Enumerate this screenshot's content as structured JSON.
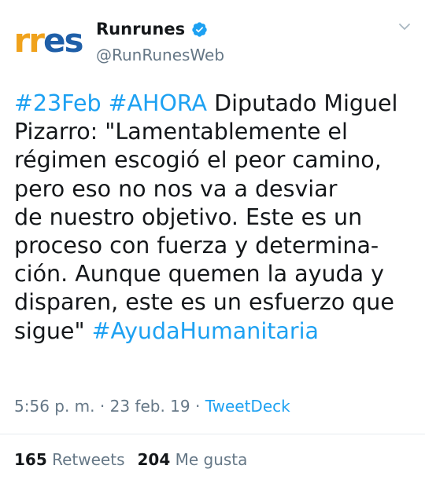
{
  "account": {
    "avatar_text_orange": "rr",
    "avatar_text_blue": "es",
    "display_name": "Runrunes",
    "verified_icon": "verified-badge-icon",
    "handle": "@RunRunesWeb",
    "menu_icon": "chevron-down-icon"
  },
  "tweet": {
    "lines": [
      [
        {
          "text": "#23Feb",
          "tag": true
        },
        {
          "text": " ",
          "tag": false
        },
        {
          "text": "#AHORA",
          "tag": true
        },
        {
          "text": " Diputado Miguel",
          "tag": false
        }
      ],
      [
        {
          "text": "Pizarro: \"Lamentablemente el",
          "tag": false
        }
      ],
      [
        {
          "text": "régimen escogió el peor camino,",
          "tag": false
        }
      ],
      [
        {
          "text": "pero eso no nos va a desviar",
          "tag": false
        }
      ],
      [
        {
          "text": "de nuestro objetivo. Este es un",
          "tag": false
        }
      ],
      [
        {
          "text": "proceso con fuerza y determina-",
          "tag": false
        }
      ],
      [
        {
          "text": "ción. Aunque quemen la ayuda y",
          "tag": false
        }
      ],
      [
        {
          "text": "disparen, este es un esfuerzo que",
          "tag": false
        }
      ],
      [
        {
          "text": "sigue\" ",
          "tag": false
        },
        {
          "text": "#AyudaHumanitaria",
          "tag": true
        }
      ]
    ],
    "time": "5:56 p. m.",
    "separator": " · ",
    "date": "23 feb. 19",
    "source": "TweetDeck"
  },
  "stats": {
    "retweets_count": "165",
    "retweets_label": "Retweets",
    "likes_count": "204",
    "likes_label": "Me gusta"
  },
  "colors": {
    "link": "#1da1f2",
    "muted": "#657786",
    "text": "#14171a",
    "avatar_orange": "#f0a21c",
    "avatar_blue": "#1f5fa8"
  }
}
